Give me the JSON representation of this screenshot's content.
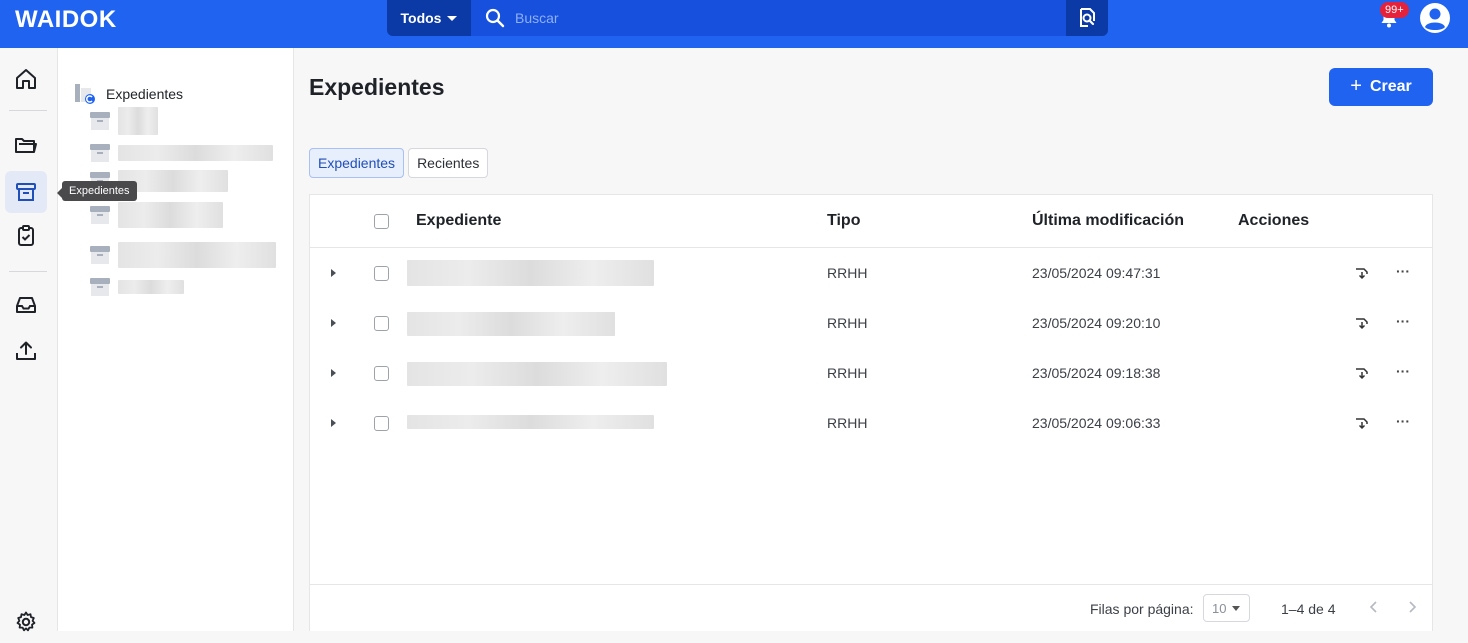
{
  "app": {
    "logo": "WAIDOK"
  },
  "search": {
    "scope": "Todos",
    "placeholder": "Buscar"
  },
  "notifications": {
    "badge": "99+"
  },
  "rail": {
    "tooltip": "Expedientes"
  },
  "tree": {
    "root_label": "Expedientes"
  },
  "main": {
    "title": "Expedientes",
    "create_label": "Crear",
    "tabs": [
      {
        "label": "Expedientes"
      },
      {
        "label": "Recientes"
      }
    ],
    "columns": {
      "expediente": "Expediente",
      "tipo": "Tipo",
      "modificacion": "Última modificación",
      "acciones": "Acciones"
    },
    "rows": [
      {
        "tipo": "RRHH",
        "modificacion": "23/05/2024 09:47:31"
      },
      {
        "tipo": "RRHH",
        "modificacion": "23/05/2024 09:20:10"
      },
      {
        "tipo": "RRHH",
        "modificacion": "23/05/2024 09:18:38"
      },
      {
        "tipo": "RRHH",
        "modificacion": "23/05/2024 09:06:33"
      }
    ],
    "pagination": {
      "rows_per_page_label": "Filas por página:",
      "rows_per_page": "10",
      "range": "1–4 de 4"
    }
  },
  "colors": {
    "brand": "#1f63f0",
    "badge": "#e5223b"
  }
}
